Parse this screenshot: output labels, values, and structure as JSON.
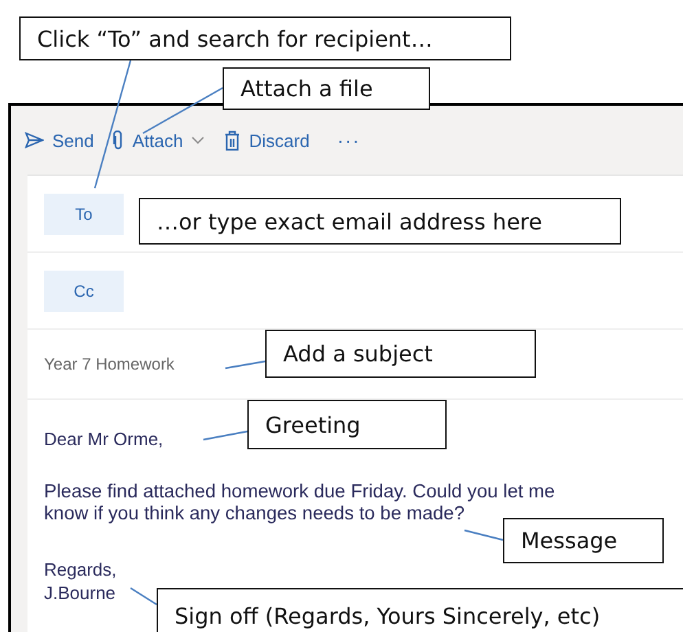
{
  "toolbar": {
    "items": [
      {
        "kind": "send",
        "label": "Send"
      },
      {
        "kind": "attach",
        "label": "Attach"
      },
      {
        "kind": "discard",
        "label": "Discard"
      },
      {
        "kind": "more",
        "label": "···"
      }
    ]
  },
  "recipients": [
    {
      "label": "To"
    },
    {
      "label": "Cc"
    }
  ],
  "subject": "Year 7 Homework",
  "body": {
    "greeting": "Dear Mr Orme,",
    "message": "Please find attached homework due Friday. Could you let me know if you think any changes needs to be made?",
    "sign_off": [
      "Regards,",
      "J.Bourne"
    ]
  },
  "callouts": [
    {
      "text": "Click “To” and search for recipient…"
    },
    {
      "text": "Attach a file"
    },
    {
      "text": "…or type exact email address here"
    },
    {
      "text": "Add a subject"
    },
    {
      "text": "Greeting"
    },
    {
      "text": "Message"
    },
    {
      "text": "Sign off (Regards, Yours Sincerely, etc)"
    }
  ]
}
